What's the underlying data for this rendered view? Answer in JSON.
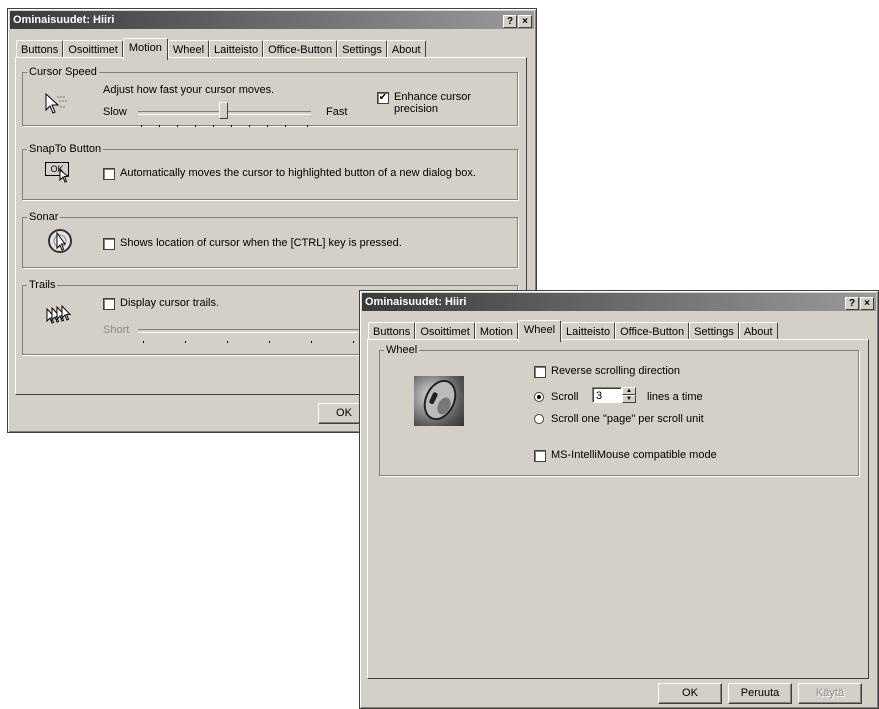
{
  "window1": {
    "title": "Ominaisuudet: Hiiri",
    "help_label": "?",
    "close_label": "×",
    "tabs": [
      "Buttons",
      "Osoittimet",
      "Motion",
      "Wheel",
      "Laitteisto",
      "Office-Button",
      "Settings",
      "About"
    ],
    "active_tab": "Motion",
    "cursor_speed": {
      "title": "Cursor Speed",
      "description": "Adjust how fast your cursor moves.",
      "slow_label": "Slow",
      "fast_label": "Fast",
      "speed_level": 0.5,
      "enhance_label": "Enhance cursor precision",
      "enhance_line1": "Enhance cursor",
      "enhance_line2": "precision",
      "enhance_checked": true
    },
    "snapto": {
      "title": "SnapTo Button",
      "ok_icon_text": "OK",
      "checkbox_label": "Automatically moves the cursor to highlighted button of a new dialog box.",
      "checked": false
    },
    "sonar": {
      "title": "Sonar",
      "checkbox_label": "Shows location of cursor when the [CTRL] key is pressed.",
      "checked": false
    },
    "trails": {
      "title": "Trails",
      "checkbox_label": "Display cursor trails.",
      "checked": false,
      "short_label": "Short"
    },
    "ok_button": "OK"
  },
  "window2": {
    "title": "Ominaisuudet: Hiiri",
    "help_label": "?",
    "close_label": "×",
    "tabs": [
      "Buttons",
      "Osoittimet",
      "Motion",
      "Wheel",
      "Laitteisto",
      "Office-Button",
      "Settings",
      "About"
    ],
    "active_tab": "Wheel",
    "wheel": {
      "title": "Wheel",
      "reverse_label": "Reverse scrolling direction",
      "reverse_checked": false,
      "scroll_label": "Scroll",
      "scroll_value": "3",
      "lines_label": "lines a time",
      "page_label": "Scroll one \"page\" per scroll unit",
      "selected_option": "Scroll",
      "intellimouse_label": "MS-IntelliMouse compatible mode",
      "intellimouse_checked": false
    },
    "ok_button": "OK",
    "cancel_button": "Peruuta",
    "apply_button": "Käytä"
  }
}
